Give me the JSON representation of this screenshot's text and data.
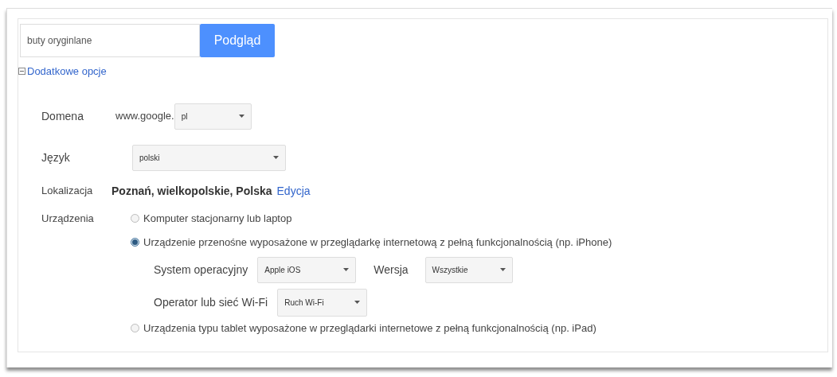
{
  "search": {
    "value": "buty oryginlane",
    "button": "Podgląd"
  },
  "options_toggle": {
    "label": "Dodatkowe opcje",
    "expanded": true
  },
  "domain": {
    "label": "Domena",
    "prefix": "www.google.",
    "value": "pl"
  },
  "language": {
    "label": "Język",
    "value": "polski"
  },
  "location": {
    "label": "Lokalizacja",
    "value": "Poznań, wielkopolskie, Polska",
    "link": "Edycja"
  },
  "devices": {
    "label": "Urządzenia",
    "options": [
      {
        "label": "Komputer stacjonarny lub laptop",
        "selected": false
      },
      {
        "label": "Urządzenie przenośne wyposażone w przeglądarkę internetową z pełną funkcjonalnością (np. iPhone)",
        "selected": true
      },
      {
        "label": "Urządzenia typu tablet wyposażone w przeglądarki internetowe z pełną funkcjonalnością (np. iPad)",
        "selected": false
      }
    ]
  },
  "mobile": {
    "os_label": "System operacyjny",
    "os_value": "Apple iOS",
    "version_label": "Wersja",
    "version_value": "Wszystkie",
    "carrier_label": "Operator lub sieć Wi-Fi",
    "carrier_value": "Ruch Wi-Fi"
  }
}
